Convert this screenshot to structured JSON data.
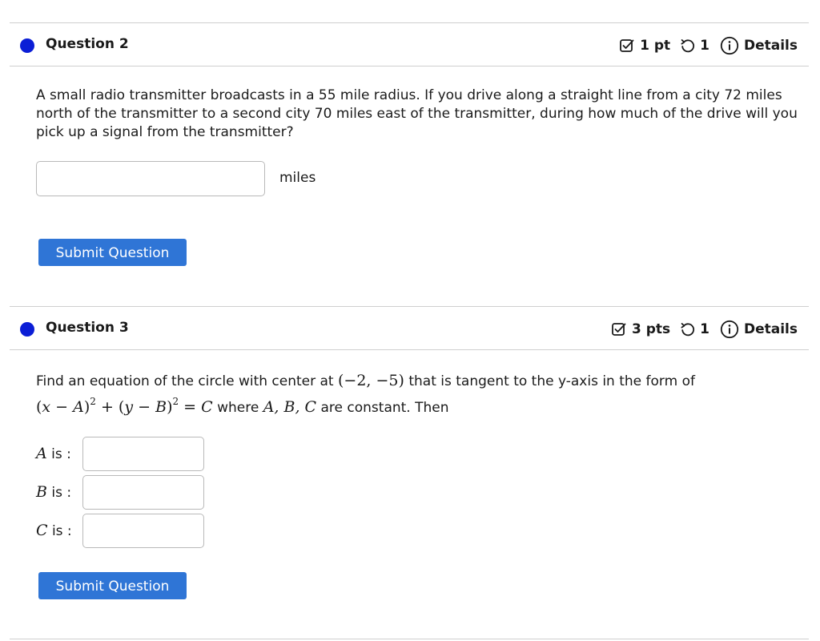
{
  "question2": {
    "title": "Question 2",
    "points": "1 pt",
    "tries": "1",
    "details_label": "Details",
    "text": "A small radio transmitter broadcasts in a 55 mile radius. If you drive along a straight line from a city 72 miles north of the transmitter to a second city 70 miles east of the transmitter, during how much of the drive will you pick up a signal from the transmitter?",
    "answer_value": "",
    "unit": "miles",
    "submit_label": "Submit Question"
  },
  "question3": {
    "title": "Question 3",
    "points": "3 pts",
    "tries": "1",
    "details_label": "Details",
    "text_part1": "Find an equation of the circle with center at",
    "center_math": "(−2, −5)",
    "text_part2": "that is tangent to the y-axis in the form of",
    "where_text": "where",
    "vars_math": "A, B, C",
    "constant_text": "are constant. Then",
    "fields": [
      {
        "var": "A",
        "suffix": "is :",
        "value": ""
      },
      {
        "var": "B",
        "suffix": "is :",
        "value": ""
      },
      {
        "var": "C",
        "suffix": "is :",
        "value": ""
      }
    ],
    "submit_label": "Submit Question"
  },
  "colors": {
    "status_dot": "#0b1ed6",
    "submit_button": "#2f75d6",
    "divider": "#cfcfcf"
  },
  "icons": {
    "points": "checkbox-edit-icon",
    "tries": "retry-icon",
    "details": "info-icon",
    "status": "status-dot-icon"
  }
}
